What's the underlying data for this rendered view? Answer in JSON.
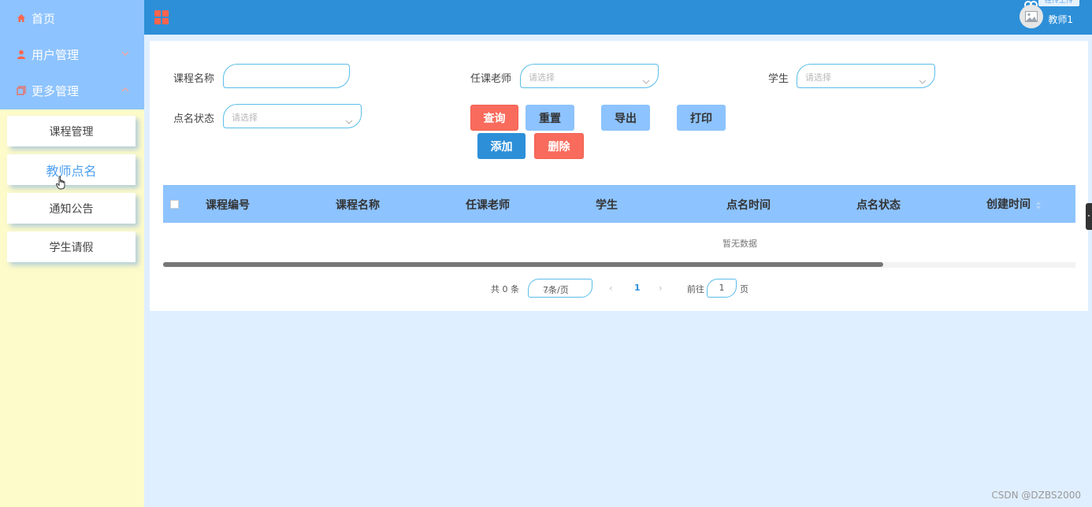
{
  "sidebar": {
    "items": [
      {
        "label": "首页",
        "icon": "home-icon"
      },
      {
        "label": "用户管理",
        "icon": "user-icon"
      },
      {
        "label": "更多管理",
        "icon": "copy-icon"
      }
    ],
    "submenu": [
      "课程管理",
      "教师点名",
      "通知公告",
      "学生请假"
    ],
    "active_sub": "教师点名"
  },
  "header": {
    "user_name": "教师1",
    "upload_chip": "经传上传"
  },
  "form": {
    "course_name_label": "课程名称",
    "teacher_label": "任课老师",
    "teacher_placeholder": "请选择",
    "student_label": "学生",
    "student_placeholder": "请选择",
    "status_label": "点名状态",
    "status_placeholder": "请选择"
  },
  "buttons": {
    "query": "查询",
    "reset": "重置",
    "export": "导出",
    "print": "打印",
    "add": "添加",
    "delete": "删除"
  },
  "table": {
    "columns": [
      "课程编号",
      "课程名称",
      "任课老师",
      "学生",
      "点名时间",
      "点名状态",
      "创建时间"
    ],
    "rows": [],
    "empty_text": "暂无数据"
  },
  "pagination": {
    "total_text": "共 0 条",
    "page_size": "7条/页",
    "current_page": "1",
    "goto_label": "前往",
    "goto_value": "1",
    "page_suffix": "页"
  },
  "watermark": "CSDN @DZBS2000",
  "colors": {
    "topbar": "#2d8fd8",
    "sidebar_top": "#8dc3fe",
    "sidebar_bg": "#fefbca",
    "accent_red": "#f96b5c",
    "accent_blue": "#8dc3fe"
  }
}
